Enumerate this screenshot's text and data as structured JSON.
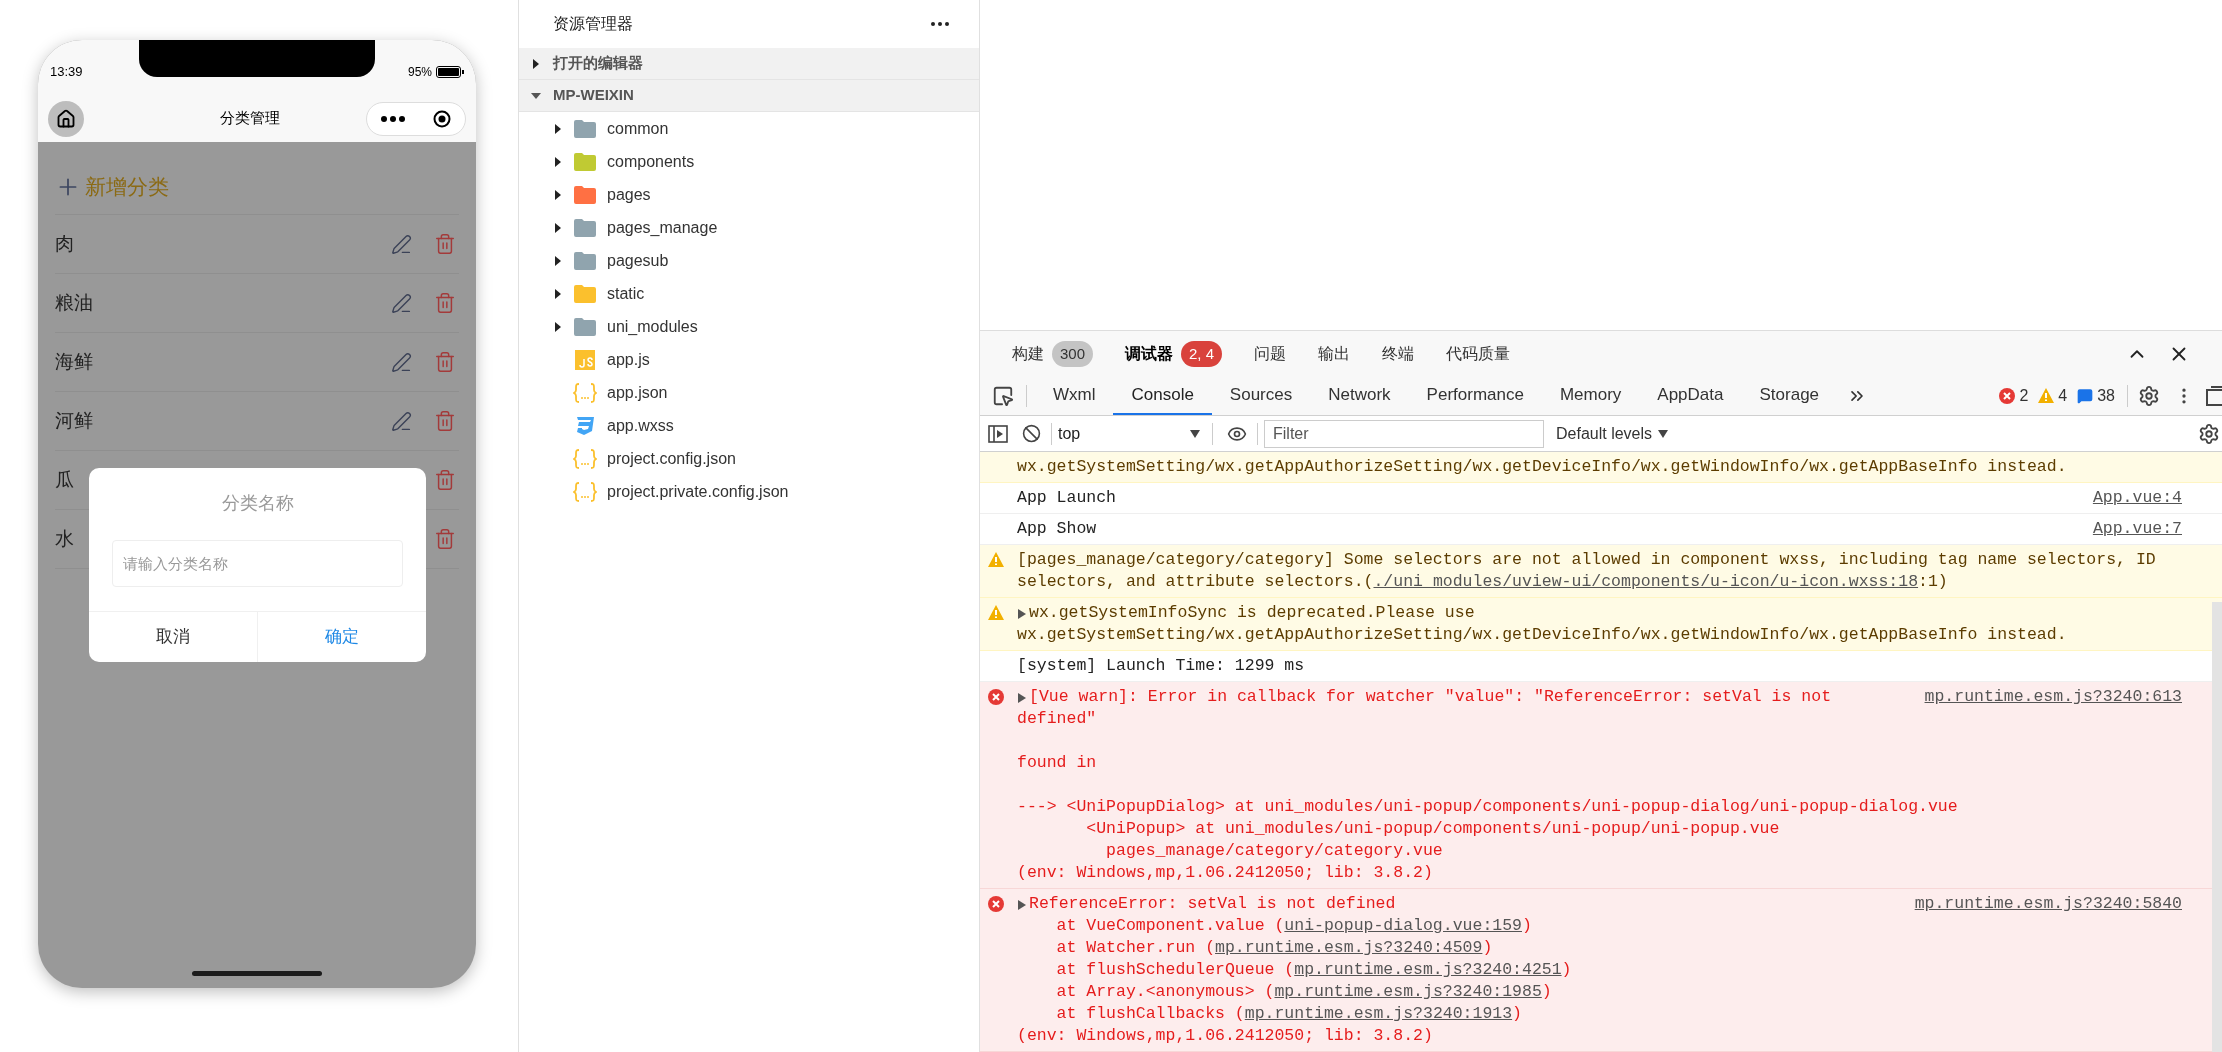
{
  "phone": {
    "time": "13:39",
    "battery": "95%",
    "nav_title": "分类管理",
    "add_label": "新增分类",
    "categories": [
      {
        "name": "肉",
        "edit_shown": true
      },
      {
        "name": "粮油",
        "edit_shown": true
      },
      {
        "name": "海鲜",
        "edit_shown": true
      },
      {
        "name": "河鲜",
        "edit_shown": true
      },
      {
        "name": "瓜",
        "edit_shown": false
      },
      {
        "name": "水",
        "edit_shown": false
      }
    ],
    "dialog": {
      "title": "分类名称",
      "placeholder": "请输入分类名称",
      "buttons": [
        {
          "label": "取消",
          "kind": "cancel"
        },
        {
          "label": "确定",
          "kind": "confirm"
        }
      ]
    }
  },
  "explorer": {
    "title": "资源管理器",
    "sections": [
      {
        "label": "打开的编辑器",
        "expanded": false
      },
      {
        "label": "MP-WEIXIN",
        "expanded": true,
        "children": [
          {
            "name": "common",
            "kind": "folder",
            "expanded": false,
            "color": "#90a4ae"
          },
          {
            "name": "components",
            "kind": "folder",
            "expanded": false,
            "color": "#c0ca33"
          },
          {
            "name": "pages",
            "kind": "folder",
            "expanded": false,
            "color": "#ff7043"
          },
          {
            "name": "pages_manage",
            "kind": "folder",
            "expanded": false,
            "color": "#90a4ae"
          },
          {
            "name": "pagesub",
            "kind": "folder",
            "expanded": false,
            "color": "#90a4ae"
          },
          {
            "name": "static",
            "kind": "folder",
            "expanded": false,
            "color": "#fbc02d"
          },
          {
            "name": "uni_modules",
            "kind": "folder",
            "expanded": false,
            "color": "#90a4ae"
          },
          {
            "name": "app.js",
            "kind": "js"
          },
          {
            "name": "app.json",
            "kind": "json"
          },
          {
            "name": "app.wxss",
            "kind": "css"
          },
          {
            "name": "project.config.json",
            "kind": "json"
          },
          {
            "name": "project.private.config.json",
            "kind": "json"
          }
        ]
      }
    ]
  },
  "devtools": {
    "panel_tabs": [
      {
        "label": "构建",
        "selected": false,
        "badge": {
          "text": "300",
          "color": "#c4c4c4"
        }
      },
      {
        "label": "调试器",
        "selected": true,
        "badge": {
          "text": "2, 4",
          "color": "#d9423c"
        }
      },
      {
        "label": "问题",
        "selected": false
      },
      {
        "label": "输出",
        "selected": false
      },
      {
        "label": "终端",
        "selected": false
      },
      {
        "label": "代码质量",
        "selected": false
      }
    ],
    "tabs": [
      {
        "label": "Wxml",
        "selected": false
      },
      {
        "label": "Console",
        "selected": true
      },
      {
        "label": "Sources",
        "selected": false
      },
      {
        "label": "Network",
        "selected": false
      },
      {
        "label": "Performance",
        "selected": false
      },
      {
        "label": "Memory",
        "selected": false
      },
      {
        "label": "AppData",
        "selected": false
      },
      {
        "label": "Storage",
        "selected": false
      }
    ],
    "counts": {
      "errors": "2",
      "warnings": "4",
      "messages": "38"
    },
    "context": "top",
    "filter_placeholder": "Filter",
    "levels": "Default levels",
    "messages": [
      {
        "kind": "warning_tail",
        "lines": [
          {
            "text": "wx.getSystemSetting/wx.getAppAuthorizeSetting/wx.getDeviceInfo/wx.getWindowInfo/wx.getAppBaseInfo instead."
          }
        ]
      },
      {
        "kind": "log",
        "source": "App.vue:4",
        "lines": [
          {
            "text": "App Launch"
          }
        ]
      },
      {
        "kind": "log",
        "source": "App.vue:7",
        "lines": [
          {
            "text": "App Show"
          }
        ]
      },
      {
        "kind": "warning",
        "expandable": false,
        "lines": [
          {
            "text": "[pages_manage/category/category] Some selectors are not allowed in component wxss, including tag name selectors, ID"
          },
          {
            "text": "selectors, and attribute selectors.(",
            "link": "./uni_modules/uview-ui/components/u-icon/u-icon.wxss:18",
            "post": ":1)"
          }
        ]
      },
      {
        "kind": "warning",
        "expandable": true,
        "lines": [
          {
            "text": "wx.getSystemInfoSync is deprecated.Please use"
          },
          {
            "text": "wx.getSystemSetting/wx.getAppAuthorizeSetting/wx.getDeviceInfo/wx.getWindowInfo/wx.getAppBaseInfo instead."
          }
        ]
      },
      {
        "kind": "log",
        "lines": [
          {
            "text": "[system] Launch Time: 1299 ms"
          }
        ]
      },
      {
        "kind": "error",
        "expandable": true,
        "source": "mp.runtime.esm.js?3240:613",
        "lines": [
          {
            "text": "[Vue warn]: Error in callback for watcher \"value\": \"ReferenceError: setVal is not"
          },
          {
            "text": "defined\""
          },
          {
            "text": "found in",
            "gap": true
          },
          {
            "text": "---> <UniPopupDialog> at uni_modules/uni-popup/components/uni-popup-dialog/uni-popup-dialog.vue",
            "gap": true
          },
          {
            "text": "       <UniPopup> at uni_modules/uni-popup/components/uni-popup/uni-popup.vue"
          },
          {
            "text": "         pages_manage/category/category.vue"
          },
          {
            "text": "(env: Windows,mp,1.06.2412050; lib: 3.8.2)"
          }
        ]
      },
      {
        "kind": "error",
        "expandable": true,
        "source": "mp.runtime.esm.js?3240:5840",
        "lines": [
          {
            "text": "ReferenceError: setVal is not defined"
          },
          {
            "text": "    at VueComponent.value (",
            "link": "uni-popup-dialog.vue:159",
            "post": ")"
          },
          {
            "text": "    at Watcher.run (",
            "link": "mp.runtime.esm.js?3240:4509",
            "post": ")"
          },
          {
            "text": "    at flushSchedulerQueue (",
            "link": "mp.runtime.esm.js?3240:4251",
            "post": ")"
          },
          {
            "text": "    at Array.<anonymous> (",
            "link": "mp.runtime.esm.js?3240:1985",
            "post": ")"
          },
          {
            "text": "    at flushCallbacks (",
            "link": "mp.runtime.esm.js?3240:1913",
            "post": ")"
          },
          {
            "text": "(env: Windows,mp,1.06.2412050; lib: 3.8.2)"
          }
        ]
      }
    ]
  }
}
